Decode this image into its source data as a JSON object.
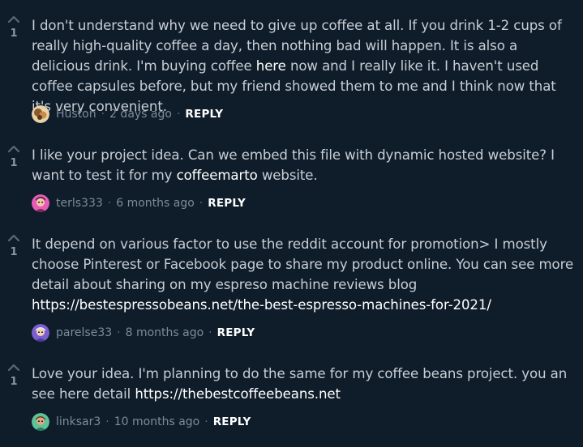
{
  "comments": [
    {
      "score": "1",
      "text_before": "I don't understand why we need to give up coffee at all. If you drink 1-2 cups of really high-quality coffee a day, then nothing bad will happen. It is also a delicious drink. I'm buying coffee ",
      "link": "here",
      "text_after": " now and I really like it. I haven't used coffee capsules before, but my friend showed them to me and I think now that it's very convenient.",
      "author": "Huston",
      "time": "2 days ago",
      "reply": "REPLY",
      "avatar_color": "#c99a5b"
    },
    {
      "score": "1",
      "text_before": "I like your project idea. Can we embed this file with dynamic hosted website? I want to test it for my ",
      "link": "coffeemarto",
      "text_after": " website.",
      "author": "terls333",
      "time": "6 months ago",
      "reply": "REPLY",
      "avatar_color": "#d94aa8"
    },
    {
      "score": "1",
      "text_before": "It depend on various factor to use the reddit account for promotion> I mostly choose Pinterest or Facebook page to share my product online. You can see more detail about sharing on my espreso machine reviews blog ",
      "link": "https://bestespressobeans.net/the-best-espresso-machines-for-2021/",
      "text_after": "",
      "author": "parelse33",
      "time": "8 months ago",
      "reply": "REPLY",
      "avatar_color": "#7b5fd0"
    },
    {
      "score": "1",
      "text_before": "Love your idea. I'm planning to do the same for my coffee beans project. you an see here detail ",
      "link": "https://thebestcoffeebeans.net",
      "text_after": "",
      "author": "linksar3",
      "time": "10 months ago",
      "reply": "REPLY",
      "avatar_color": "#5cc39a"
    }
  ]
}
